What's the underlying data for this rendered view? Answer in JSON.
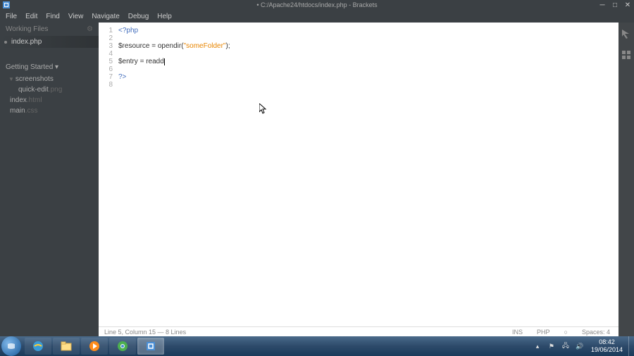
{
  "window": {
    "title": "• C:/Apache24/htdocs/index.php - Brackets"
  },
  "menu": {
    "items": [
      "File",
      "Edit",
      "Find",
      "View",
      "Navigate",
      "Debug",
      "Help"
    ]
  },
  "sidebar": {
    "working_files_label": "Working Files",
    "working_files": [
      {
        "name": "index.php",
        "dirty": true,
        "active": true
      }
    ],
    "getting_started_label": "Getting Started ▾",
    "tree": {
      "folder": "screenshots",
      "files": [
        {
          "base": "quick-edit",
          "ext": ".png"
        },
        {
          "base": "index",
          "ext": ".html"
        },
        {
          "base": "main",
          "ext": ".css"
        }
      ]
    }
  },
  "editor": {
    "lines": [
      {
        "n": 1,
        "tokens": [
          {
            "t": "<?php",
            "c": "kw"
          }
        ]
      },
      {
        "n": 2,
        "tokens": []
      },
      {
        "n": 3,
        "tokens": [
          {
            "t": "$resource",
            "c": "var"
          },
          {
            "t": " = ",
            "c": "op"
          },
          {
            "t": "opendir",
            "c": "fn"
          },
          {
            "t": "(",
            "c": "op"
          },
          {
            "t": "\"someFolder\"",
            "c": "str"
          },
          {
            "t": ");",
            "c": "op"
          }
        ]
      },
      {
        "n": 4,
        "tokens": []
      },
      {
        "n": 5,
        "tokens": [
          {
            "t": "$entry",
            "c": "var"
          },
          {
            "t": " = ",
            "c": "op"
          },
          {
            "t": "readd",
            "c": "fn"
          }
        ],
        "cursor": true
      },
      {
        "n": 6,
        "tokens": []
      },
      {
        "n": 7,
        "tokens": [
          {
            "t": "?>",
            "c": "kw"
          }
        ]
      },
      {
        "n": 8,
        "tokens": []
      }
    ]
  },
  "status": {
    "position": "Line 5, Column 15 — 8 Lines",
    "ins": "INS",
    "lang": "PHP",
    "spaces": "Spaces: 4"
  },
  "systray": {
    "time": "08:42",
    "date": "19/06/2014"
  }
}
